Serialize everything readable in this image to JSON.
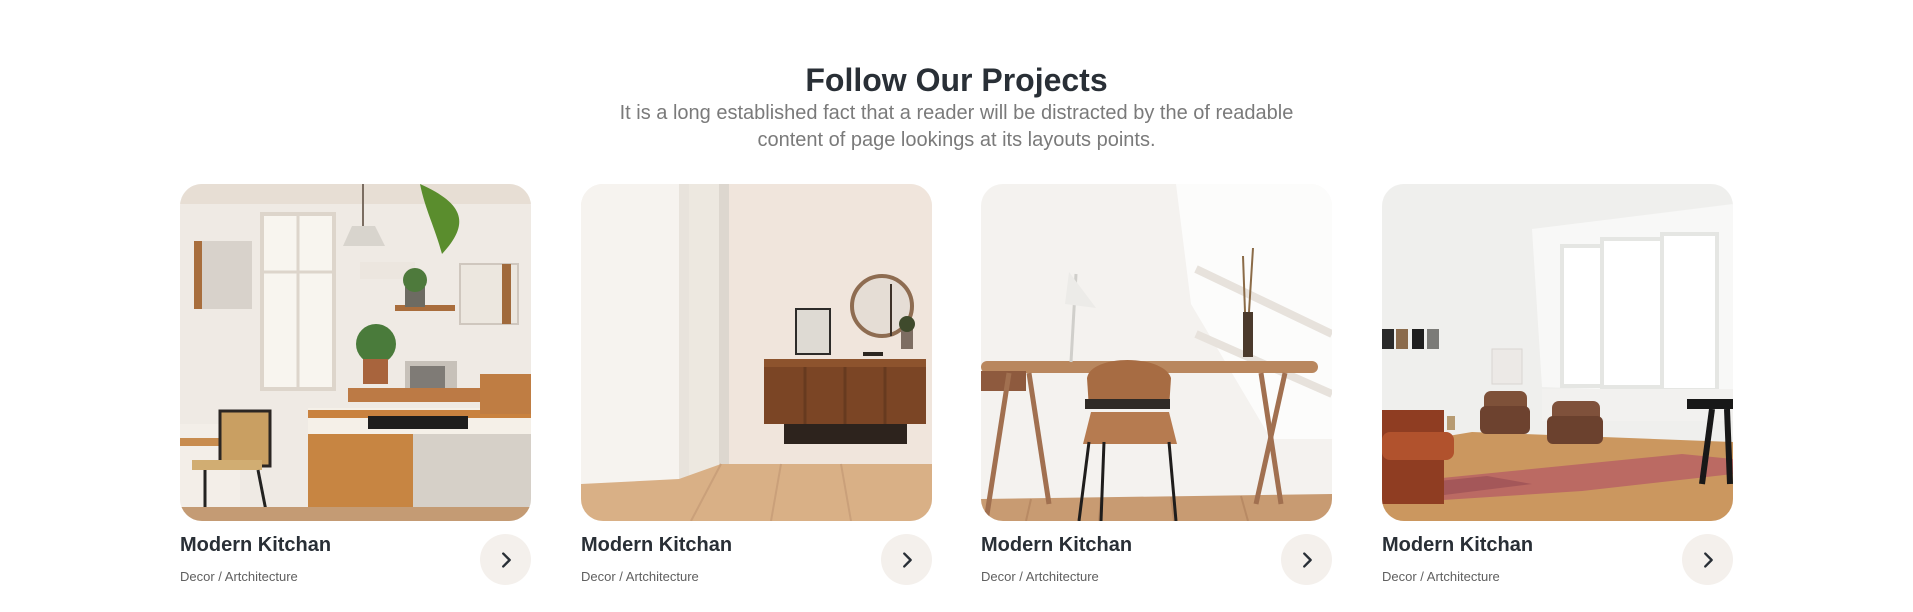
{
  "section": {
    "title": "Follow Our Projects",
    "subtitle": "It is a long established fact that a reader will be distracted by the of readable content of page lookings at its layouts points."
  },
  "projects": [
    {
      "title": "Modern Kitchan",
      "category": "Decor / Artchitecture",
      "image_icon": "kitchen-photo",
      "action_icon": "chevron-right-icon"
    },
    {
      "title": "Modern Kitchan",
      "category": "Decor / Artchitecture",
      "image_icon": "hallway-sideboard-photo",
      "action_icon": "chevron-right-icon"
    },
    {
      "title": "Modern Kitchan",
      "category": "Decor / Artchitecture",
      "image_icon": "desk-chair-photo",
      "action_icon": "chevron-right-icon"
    },
    {
      "title": "Modern Kitchan",
      "category": "Decor / Artchitecture",
      "image_icon": "living-room-photo",
      "action_icon": "chevron-right-icon"
    }
  ],
  "colors": {
    "heading": "#292f36",
    "subtitle": "#7a7a7a",
    "meta": "#5f5f5f",
    "button_background": "#f4f0ec",
    "page_background": "#ffffff"
  }
}
